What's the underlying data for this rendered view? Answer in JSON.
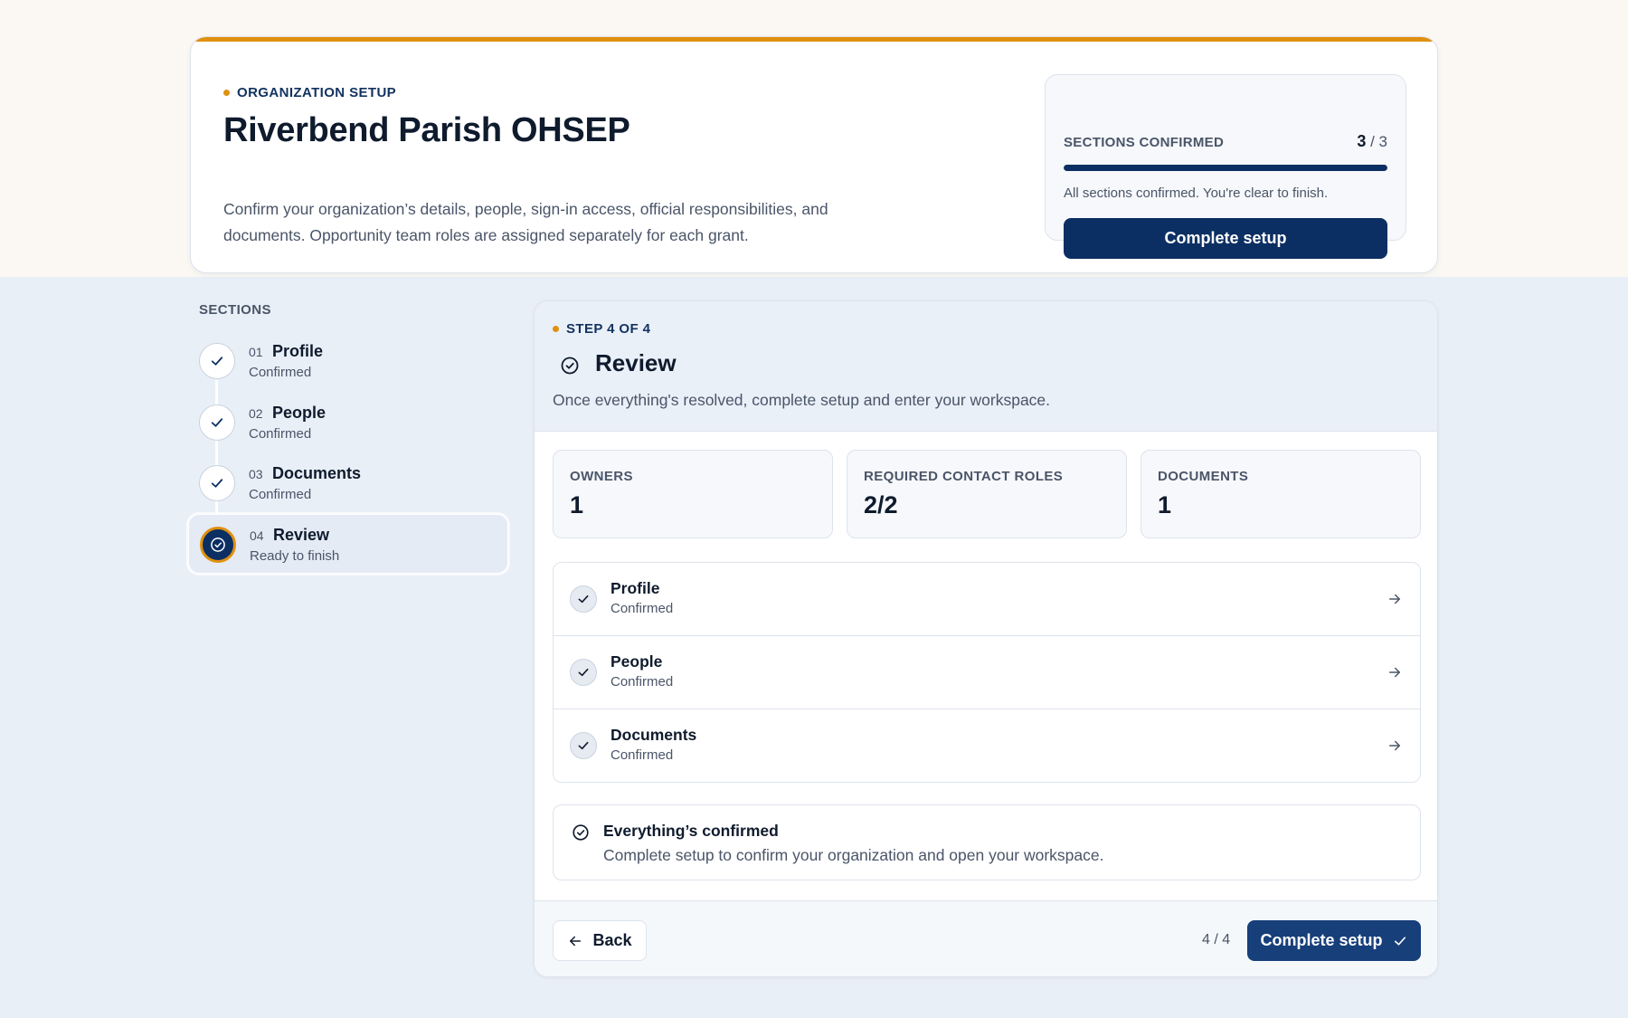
{
  "header": {
    "eyebrow": "ORGANIZATION SETUP",
    "org_name": "Riverbend Parish OHSEP",
    "description": "Confirm your organization’s details, people, sign-in access, official responsibilities, and documents. Opportunity team roles are assigned separately for each grant.",
    "accent_color": "#e0900f"
  },
  "progress": {
    "label": "SECTIONS CONFIRMED",
    "confirmed": "3",
    "total": "/ 3",
    "fraction": 1.0,
    "note": "All sections confirmed. You're clear to finish.",
    "button_label": "Complete setup"
  },
  "sidebar": {
    "title": "SECTIONS",
    "steps": [
      {
        "num": "01",
        "name": "Profile",
        "status": "Confirmed",
        "icon": "check-icon"
      },
      {
        "num": "02",
        "name": "People",
        "status": "Confirmed",
        "icon": "check-icon"
      },
      {
        "num": "03",
        "name": "Documents",
        "status": "Confirmed",
        "icon": "check-icon"
      },
      {
        "num": "04",
        "name": "Review",
        "status": "Ready to finish",
        "icon": "check-circle-icon"
      }
    ]
  },
  "main": {
    "eyebrow": "STEP 4 OF 4",
    "title": "Review",
    "description": "Once everything's resolved, complete setup and enter your workspace.",
    "stats": [
      {
        "label": "OWNERS",
        "value": "1"
      },
      {
        "label": "REQUIRED CONTACT ROLES",
        "value": "2/2"
      },
      {
        "label": "DOCUMENTS",
        "value": "1"
      }
    ],
    "rows": [
      {
        "name": "Profile",
        "status": "Confirmed"
      },
      {
        "name": "People",
        "status": "Confirmed"
      },
      {
        "name": "Documents",
        "status": "Confirmed"
      }
    ],
    "notice": {
      "title": "Everything’s confirmed",
      "text": "Complete setup to confirm your organization and open your workspace."
    }
  },
  "footer": {
    "back_label": "Back",
    "pager": "4 / 4",
    "finish_label": "Complete setup"
  },
  "colors": {
    "primary": "#0c2f63",
    "accent": "#e0900f",
    "background": "#e9eff7"
  }
}
